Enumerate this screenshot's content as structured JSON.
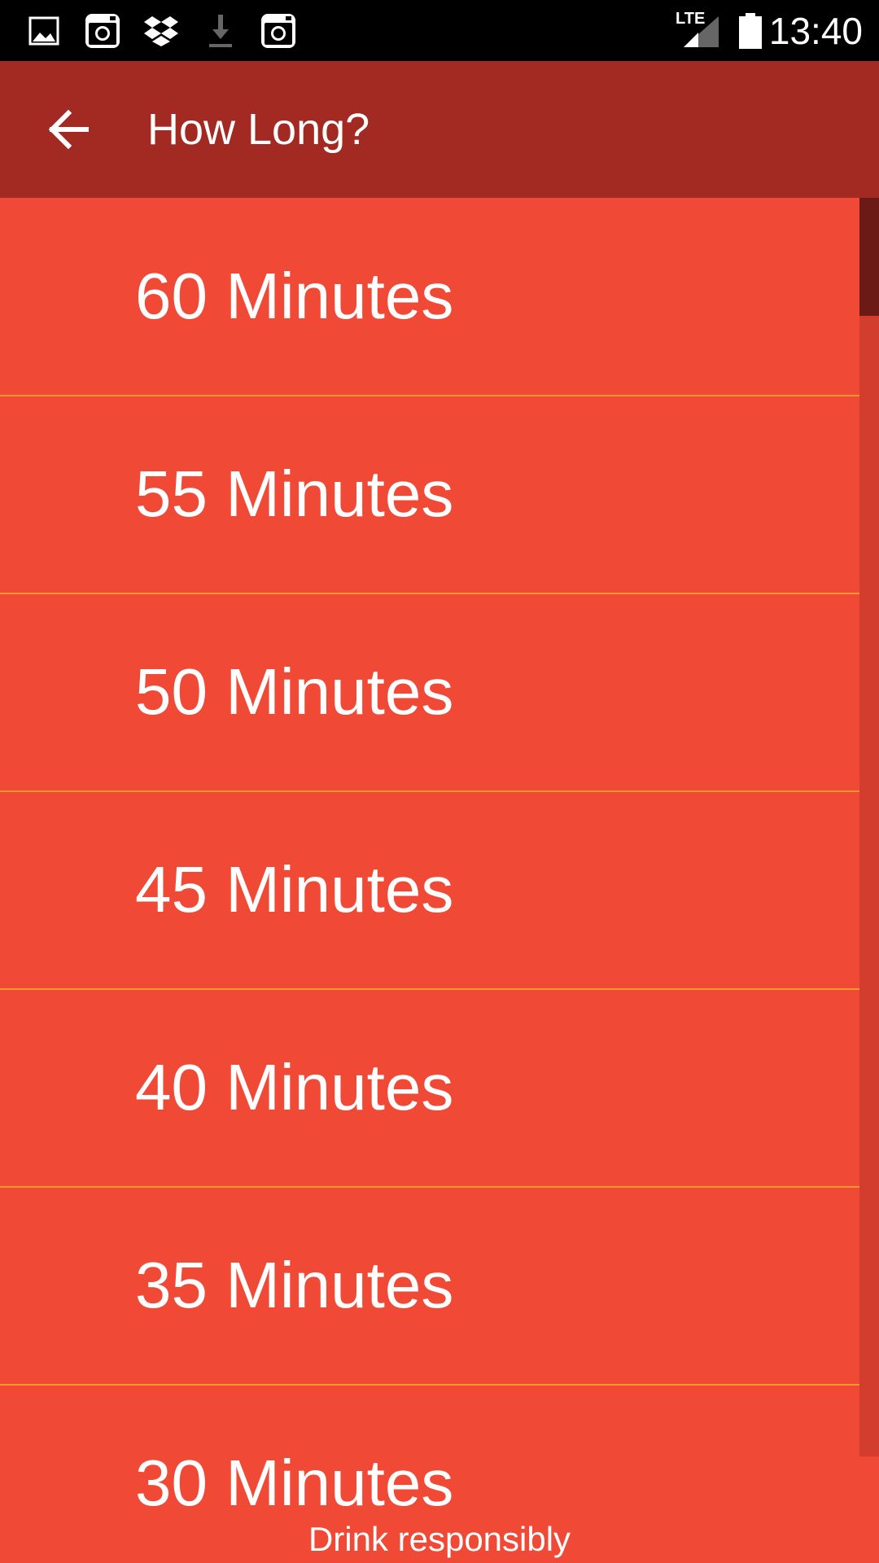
{
  "status_bar": {
    "time": "13:40",
    "network_label": "LTE",
    "icons": [
      "gallery-icon",
      "instagram-icon",
      "dropbox-icon",
      "download-icon",
      "instagram-icon",
      "signal-icon",
      "battery-icon"
    ]
  },
  "app_bar": {
    "title": "How Long?",
    "back_icon": "arrow-back-icon"
  },
  "list": {
    "items": [
      {
        "label": "60 Minutes"
      },
      {
        "label": "55 Minutes"
      },
      {
        "label": "50 Minutes"
      },
      {
        "label": "45 Minutes"
      },
      {
        "label": "40 Minutes"
      },
      {
        "label": "35 Minutes"
      },
      {
        "label": "30 Minutes"
      }
    ]
  },
  "footer": {
    "text": "Drink responsibly"
  },
  "colors": {
    "status_bar_bg": "#000000",
    "app_bar_bg": "#a32a23",
    "list_bg": "#f04a37",
    "divider": "#f29a2a",
    "scrollbar_thumb": "#6b1a15",
    "text": "#ffffff"
  }
}
